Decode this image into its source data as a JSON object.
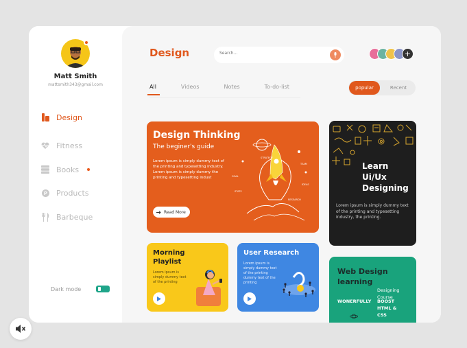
{
  "user": {
    "name": "Matt Smith",
    "email": "mattsmith343@gmail.com"
  },
  "sidebar": {
    "items": [
      {
        "label": "Design",
        "icon": "design-icon",
        "active": true
      },
      {
        "label": "Fitness",
        "icon": "heartbeat-icon",
        "active": false
      },
      {
        "label": "Books",
        "icon": "books-icon",
        "active": false,
        "badge": true
      },
      {
        "label": "Products",
        "icon": "products-icon",
        "active": false
      },
      {
        "label": "Barbeque",
        "icon": "cutlery-icon",
        "active": false
      }
    ],
    "dark_mode_label": "Dark mode",
    "dark_mode_on": true
  },
  "header": {
    "title": "Design",
    "search_placeholder": "Search..."
  },
  "tabs": [
    {
      "label": "All",
      "active": true
    },
    {
      "label": "Videos"
    },
    {
      "label": "Notes"
    },
    {
      "label": "To-do-list"
    }
  ],
  "sort": {
    "popular": "popular",
    "recent": "Recent",
    "selected": "popular"
  },
  "cards": {
    "design_thinking": {
      "title": "Design Thinking",
      "subtitle": "The beginer's guide",
      "body": "Lorem ipsum is simply dummy text of the printing and typesetting industry. Lorem ipsum is simply dummy the printing and typesetting indust",
      "button": "Read More",
      "labels": [
        "STRATEGY",
        "TEAM",
        "GOAL",
        "STATS",
        "IDEAS",
        "RESEARCH"
      ]
    },
    "uiux": {
      "title_lines": [
        "Learn",
        "Ui/Ux",
        "Designing"
      ],
      "body": "Lorem ipsum is simply dummy text of the printing and typesetting industry, the printing."
    },
    "morning": {
      "title_lines": [
        "Morning",
        "Playlist"
      ],
      "body": "Lorem ipsum is simply dummy text of the printing"
    },
    "research": {
      "title": "User Research",
      "body": "Lorem ipsum is simply dummy text of the printing dummy text of the printing"
    },
    "web": {
      "title_lines": [
        "Web Design",
        "learning"
      ],
      "course_label": "Designing Course",
      "left_label": "WONERFULLY",
      "tags": [
        "BOOST",
        "HTML &",
        "CSS"
      ]
    }
  },
  "colors": {
    "accent": "#e0581d",
    "orange_card": "#e45e1d",
    "dark_card": "#1e1e1e",
    "yellow_card": "#f9c81a",
    "blue_card": "#3f87e2",
    "green_card": "#19a37c",
    "toggle": "#1fa58a"
  }
}
